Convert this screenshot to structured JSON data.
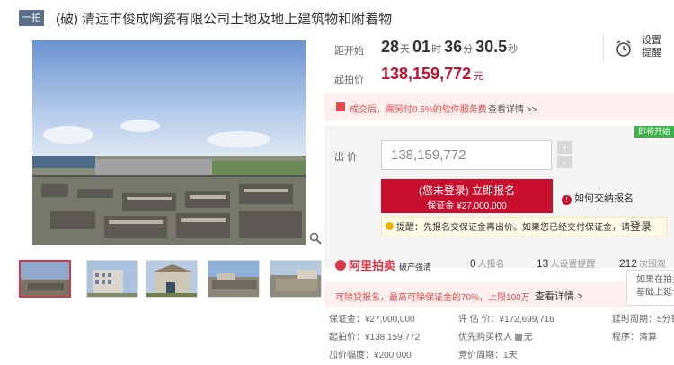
{
  "header": {
    "round_badge": "一拍",
    "title": "(破) 清远市俊成陶瓷有限公司土地及地上建筑物和附着物"
  },
  "gallery": {
    "thumbnails": [
      "thumb-1",
      "thumb-2",
      "thumb-3",
      "thumb-4",
      "thumb-5"
    ],
    "zoom_icon": "magnifier-icon"
  },
  "countdown": {
    "label": "距开始",
    "days": "28",
    "days_unit": "天",
    "hours": "01",
    "hours_unit": "时",
    "minutes": "36",
    "minutes_unit": "分",
    "seconds": "30.5",
    "seconds_unit": "秒"
  },
  "remind": {
    "label": "设置提醒",
    "icon": "alarm-clock-icon"
  },
  "start_price": {
    "label": "起拍价",
    "value": "138,159,772",
    "unit": "元"
  },
  "notice": {
    "text": "成交后，需另付0.5%的软件服务费",
    "link": "查看详情 >>"
  },
  "bid": {
    "badge": "即将开始",
    "label": "出 价",
    "value": "138,159,772",
    "plus": "+",
    "minus": "-",
    "signup_line1": "(您未登录) 立即报名",
    "signup_line2": "保证金 ¥27,000,000",
    "howto": "如何交纳报名",
    "tip": "提醒：先报名交保证金再出价。如果您已经交付保证金，请",
    "tip_login": "登录"
  },
  "platform": {
    "logo": "阿里拍卖",
    "logo_sub": "破产强清",
    "signups_num": "0",
    "signups_label": "人报名",
    "reminders_num": "13",
    "reminders_label": "人设置提醒",
    "views_num": "212",
    "views_label": "次围观"
  },
  "tooltip": {
    "line1": "如果在拍卖结束前",
    "line2": "基础上延长5分钟"
  },
  "deposit_promo": {
    "text": "可除贷报名，最高可除保证金的70%，上限100万",
    "link": "查看详情 >"
  },
  "info": {
    "deposit": "保证金：¥27,000,000",
    "appraisal": "评 估 价：¥172,699,716",
    "delay": "延时周期：5分钟",
    "start": "起拍价：¥138,159,772",
    "priority_label": "优先购买权人",
    "priority_value": "无",
    "procedure": "程序：清算",
    "increment": "加价幅度：¥200,000",
    "cycle": "竞价周期：1天"
  },
  "colors": {
    "accent_red": "#c8102e",
    "badge_green": "#3cb34a",
    "badge_blue": "#5a6f8c"
  }
}
